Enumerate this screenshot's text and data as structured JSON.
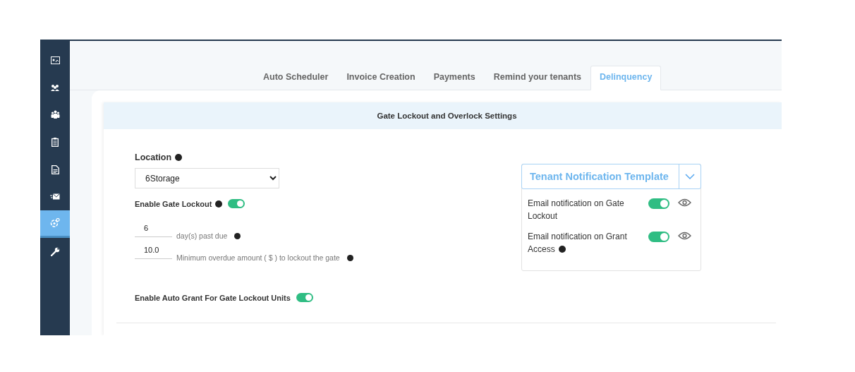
{
  "sidebar": {
    "items": [
      {
        "kind": "dashboard",
        "selected": false
      },
      {
        "kind": "users",
        "selected": false
      },
      {
        "kind": "group",
        "selected": false
      },
      {
        "kind": "clipboard",
        "selected": false
      },
      {
        "kind": "document",
        "selected": false
      },
      {
        "kind": "mail",
        "selected": false
      },
      {
        "kind": "gears",
        "selected": true
      },
      {
        "kind": "wrench",
        "selected": false
      }
    ]
  },
  "tabs": [
    {
      "label": "Auto Scheduler",
      "selected": false
    },
    {
      "label": "Invoice Creation",
      "selected": false
    },
    {
      "label": "Payments",
      "selected": false
    },
    {
      "label": "Remind your tenants",
      "selected": false
    },
    {
      "label": "Delinquency",
      "selected": true
    }
  ],
  "panel": {
    "title": "Gate Lockout and Overlock Settings",
    "location": {
      "label": "Location",
      "value": "6Storage"
    },
    "gate_lockout": {
      "label": "Enable Gate Lockout",
      "on": true
    },
    "days_past_due": {
      "value": "6",
      "label": "day(s) past due"
    },
    "min_amount": {
      "value": "10.0",
      "label": "Minimum overdue amount ( $ ) to lockout the gate"
    },
    "auto_grant": {
      "label": "Enable Auto Grant For Gate Lockout Units",
      "on": true
    },
    "template": {
      "title": "Tenant Notification Template",
      "items": [
        {
          "label": "Email notification on Gate Lockout",
          "info": false,
          "on": true
        },
        {
          "label": "Email notification on Grant Access",
          "info": true,
          "on": true
        }
      ]
    }
  }
}
